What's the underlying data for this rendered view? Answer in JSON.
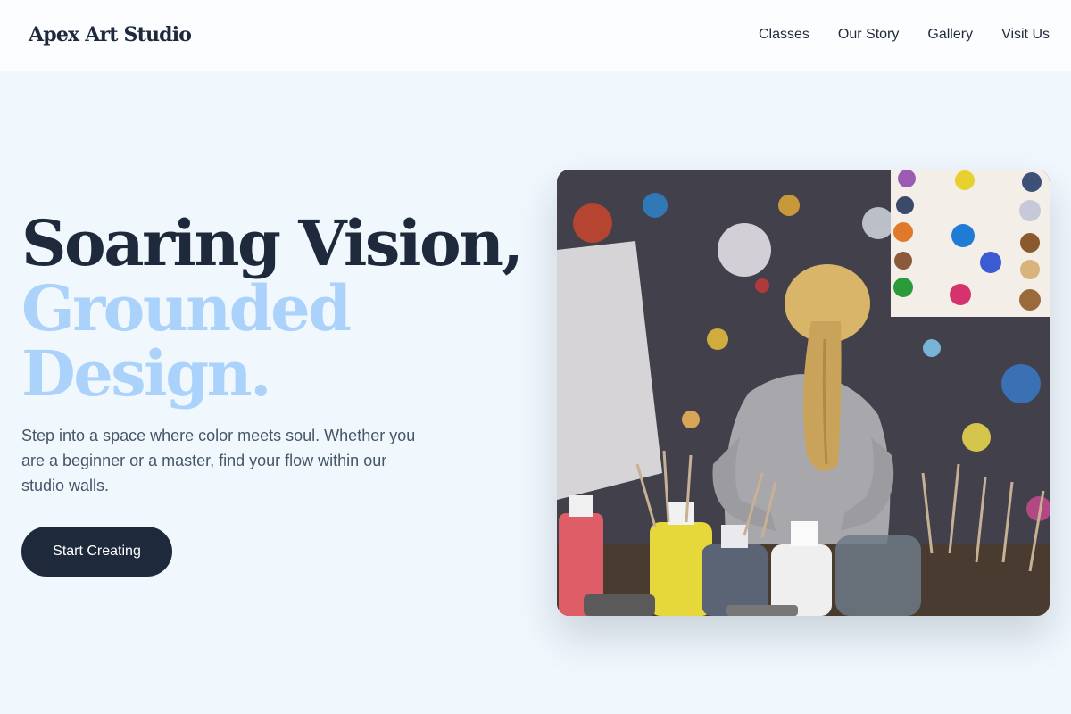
{
  "brand": {
    "name": "Apex Art Studio"
  },
  "nav": {
    "links": [
      "Classes",
      "Our Story",
      "Gallery",
      "Visit Us"
    ]
  },
  "hero": {
    "title_line_1": "Soaring Vision,",
    "title_line_2": "Grounded",
    "title_line_3": "Design.",
    "description": "Step into a space where color meets soul. Whether you are a beginner or a master, find your flow within our studio walls.",
    "cta_label": "Start Creating"
  },
  "colors": {
    "background": "#f0f7fd",
    "primary_dark": "#1e293b",
    "accent_light_blue": "#aad2fb",
    "body_text": "#475569"
  }
}
